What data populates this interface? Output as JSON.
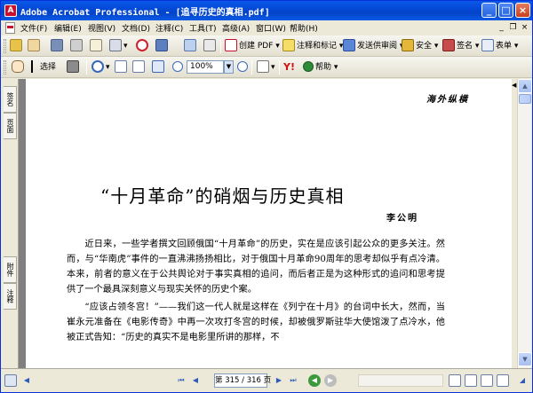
{
  "window": {
    "title": "Adobe Acrobat Professional - [追寻历史的真相.pdf]",
    "controls": {
      "minimize": "_",
      "maximize": "□",
      "close": "×"
    }
  },
  "menu": {
    "items": [
      "文件(F)",
      "编辑(E)",
      "视图(V)",
      "文档(D)",
      "注释(C)",
      "工具(T)",
      "高级(A)",
      "窗口(W)",
      "帮助(H)"
    ]
  },
  "toolbar1": {
    "create_pdf": "创建 PDF",
    "comment_markup": "注释和标记",
    "send_review": "发送供审阅",
    "security": "安全",
    "sign": "签名",
    "forms": "表单"
  },
  "toolbar2": {
    "select": "选择",
    "zoom": "100%",
    "help": "帮助"
  },
  "sidebar": {
    "tabs": [
      "签名",
      "页面",
      "附件",
      "注释"
    ]
  },
  "document": {
    "running_head": "海外纵横",
    "title": "“十月革命”的硝烟与历史真相",
    "author": "李公明",
    "paragraphs": [
      "近日来，一些学者撰文回顾俄国“十月革命”的历史，实在是应该引起公众的更多关注。然而，与“华南虎”事件的一直沸沸扬扬相比，对于俄国十月革命90周年的思考却似乎有点冷清。本来，前者的意义在于公共舆论对于事实真相的追问，而后者正是为这种形式的追问和思考提供了一个最具深刻意义与现实关怀的历史个案。",
      "“应该占领冬宫！”——我们这一代人就是这样在《列宁在十月》的台词中长大，然而，当崔永元准备在《电影传奇》中再一次攻打冬宫的时候，却被俄罗斯驻华大使馆泼了点冷水，他被正式告知：“历史的真实不是电影里所讲的那样，不"
    ]
  },
  "status": {
    "page_indicator": "第 315 / 316 页"
  }
}
